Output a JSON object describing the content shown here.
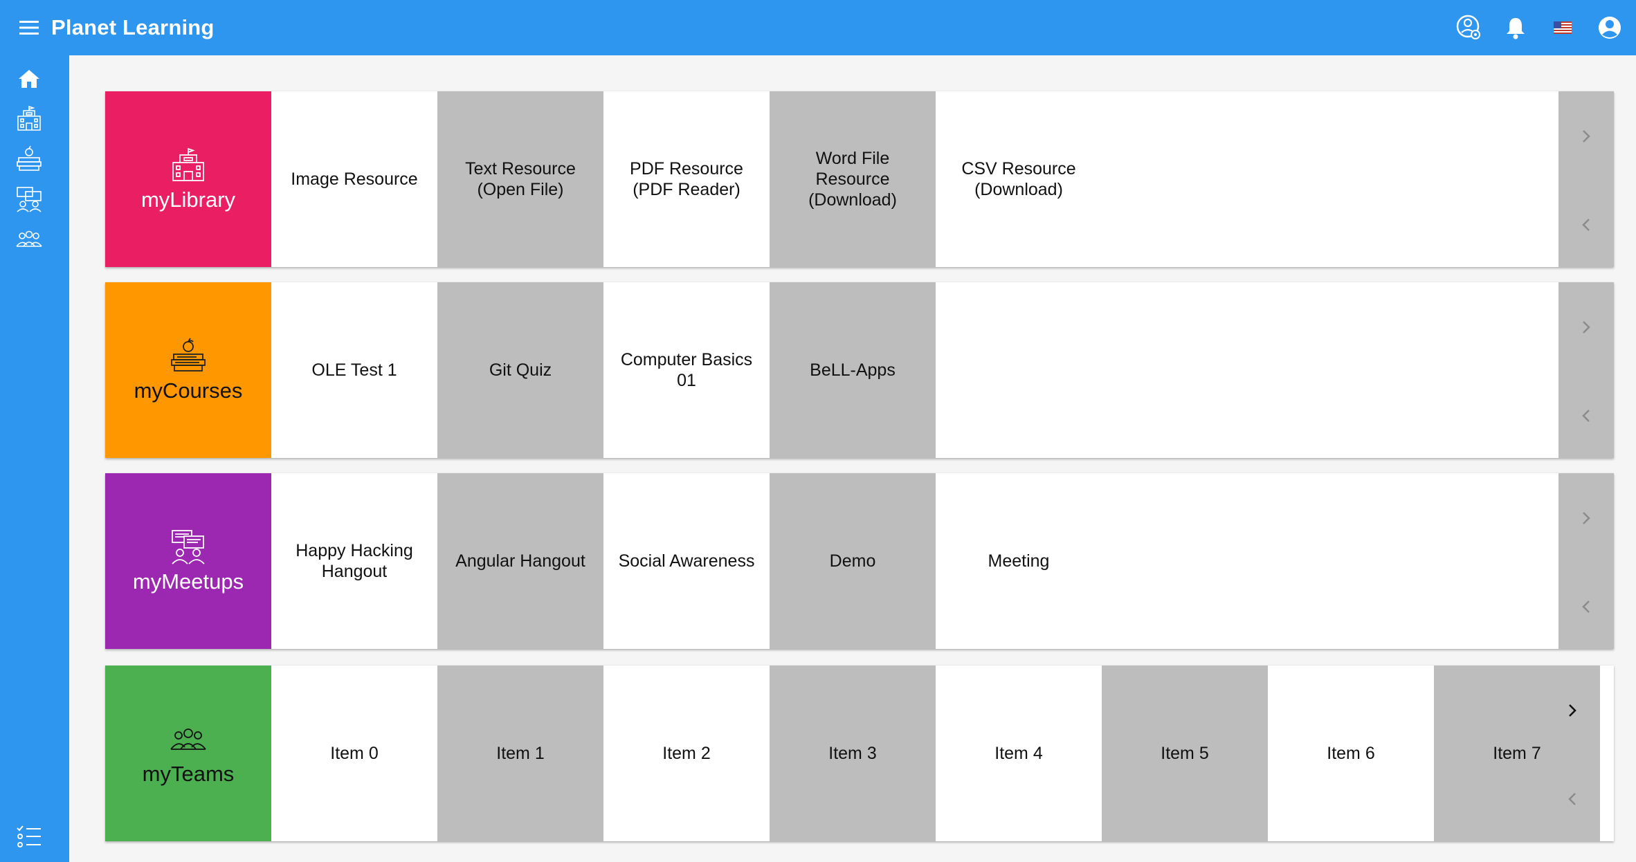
{
  "app": {
    "title": "Planet Learning"
  },
  "colors": {
    "primary": "#2f96ef",
    "library": "#e91e63",
    "courses": "#ff9800",
    "meetups": "#9c27b0",
    "teams": "#4caf50",
    "tile_gray": "#bdbdbd"
  },
  "topbar_icons": [
    "help-settings-icon",
    "bell-icon",
    "us-flag-icon",
    "account-circle-icon"
  ],
  "sidebar_icons": [
    "home-icon",
    "library-icon",
    "courses-icon",
    "meetups-icon",
    "teams-icon",
    "feedback-list-icon"
  ],
  "rows": {
    "library": {
      "title": "myLibrary",
      "items": [
        "Image Resource",
        "Text Resource (Open File)",
        "PDF Resource (PDF Reader)",
        "Word File Resource (Download)",
        "CSV Resource (Download)"
      ]
    },
    "courses": {
      "title": "myCourses",
      "items": [
        "OLE Test 1",
        "Git Quiz",
        "Computer Basics 01",
        "BeLL-Apps"
      ]
    },
    "meetups": {
      "title": "myMeetups",
      "items": [
        "Happy Hacking Hangout",
        "Angular Hangout",
        "Social Awareness",
        "Demo",
        "Meeting"
      ]
    },
    "teams": {
      "title": "myTeams",
      "items": [
        "Item 0",
        "Item 1",
        "Item 2",
        "Item 3",
        "Item 4",
        "Item 5",
        "Item 6",
        "Item 7"
      ]
    }
  }
}
